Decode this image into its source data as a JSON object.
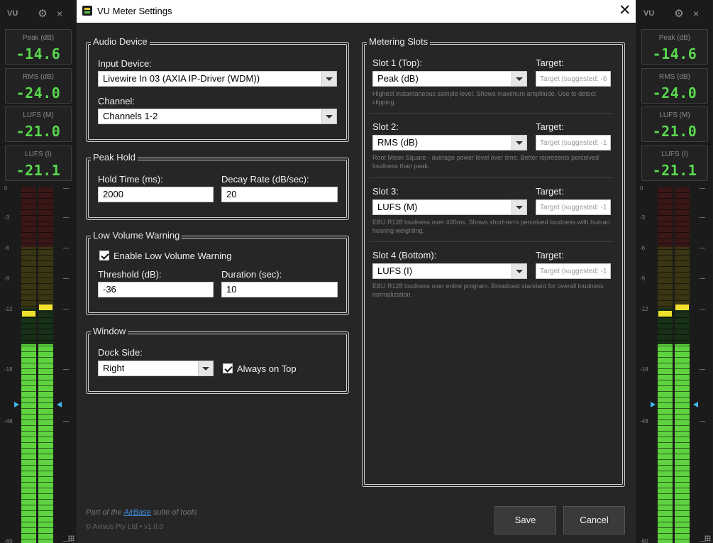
{
  "meter": {
    "title": "VU",
    "readouts": [
      {
        "label": "Peak (dB)",
        "value": "-14.6"
      },
      {
        "label": "RMS (dB)",
        "value": "-24.0"
      },
      {
        "label": "LUFS (M)",
        "value": "-21.0"
      },
      {
        "label": "LUFS (I)",
        "value": "-21.1"
      }
    ],
    "scale": [
      "0",
      "-3",
      "-6",
      "-9",
      "-12",
      "-18",
      "-48",
      "-60"
    ],
    "channel_levels_db": [
      -18,
      -18
    ],
    "peak_hold_db": [
      -12,
      -12
    ],
    "colors": {
      "green": "#5ed33f",
      "yellow": "#c6b21f",
      "red": "#b72d2d",
      "peak": "#f2e12c",
      "marker": "#3fb8e8"
    }
  },
  "dialog": {
    "title": "VU Meter Settings",
    "audio_device": {
      "group_title": "Audio Device",
      "input_label": "Input Device:",
      "input_value": "Livewire In 03 (AXIA IP-Driver (WDM))",
      "channel_label": "Channel:",
      "channel_value": "Channels 1-2"
    },
    "peak_hold": {
      "group_title": "Peak Hold",
      "hold_label": "Hold Time (ms):",
      "hold_value": "2000",
      "decay_label": "Decay Rate (dB/sec):",
      "decay_value": "20"
    },
    "low_volume": {
      "group_title": "Low Volume Warning",
      "enable_label": "Enable Low Volume Warning",
      "enabled": true,
      "threshold_label": "Threshold (dB):",
      "threshold_value": "-36",
      "duration_label": "Duration (sec):",
      "duration_value": "10"
    },
    "window": {
      "group_title": "Window",
      "dock_label": "Dock Side:",
      "dock_value": "Right",
      "always_on_top_label": "Always on Top",
      "always_on_top": true
    },
    "metering_slots": {
      "group_title": "Metering Slots",
      "target_label": "Target:",
      "slots": [
        {
          "label": "Slot 1 (Top):",
          "value": "Peak (dB)",
          "target_placeholder": "Target (suggested: -6",
          "description": "Highest instantaneous sample level. Shows maximum amplitude. Use to detect clipping."
        },
        {
          "label": "Slot 2:",
          "value": "RMS (dB)",
          "target_placeholder": "Target (suggested: -1",
          "description": "Root Mean Square - average power level over time. Better represents perceived loudness than peak."
        },
        {
          "label": "Slot 3:",
          "value": "LUFS (M)",
          "target_placeholder": "Target (suggested: -1",
          "description": "EBU R128 loudness over 400ms. Shows short-term perceived loudness with human hearing weighting."
        },
        {
          "label": "Slot 4 (Bottom):",
          "value": "LUFS (I)",
          "target_placeholder": "Target (suggested: -1",
          "description": "EBU R128 loudness over entire program. Broadcast standard for overall loudness normalization."
        }
      ]
    },
    "footer": {
      "prefix": "Part of the ",
      "link": "AirBase",
      "suffix": " suite of tools",
      "copyright": "© Axivus Pty Ltd • v1.0.0"
    },
    "save_label": "Save",
    "cancel_label": "Cancel"
  }
}
